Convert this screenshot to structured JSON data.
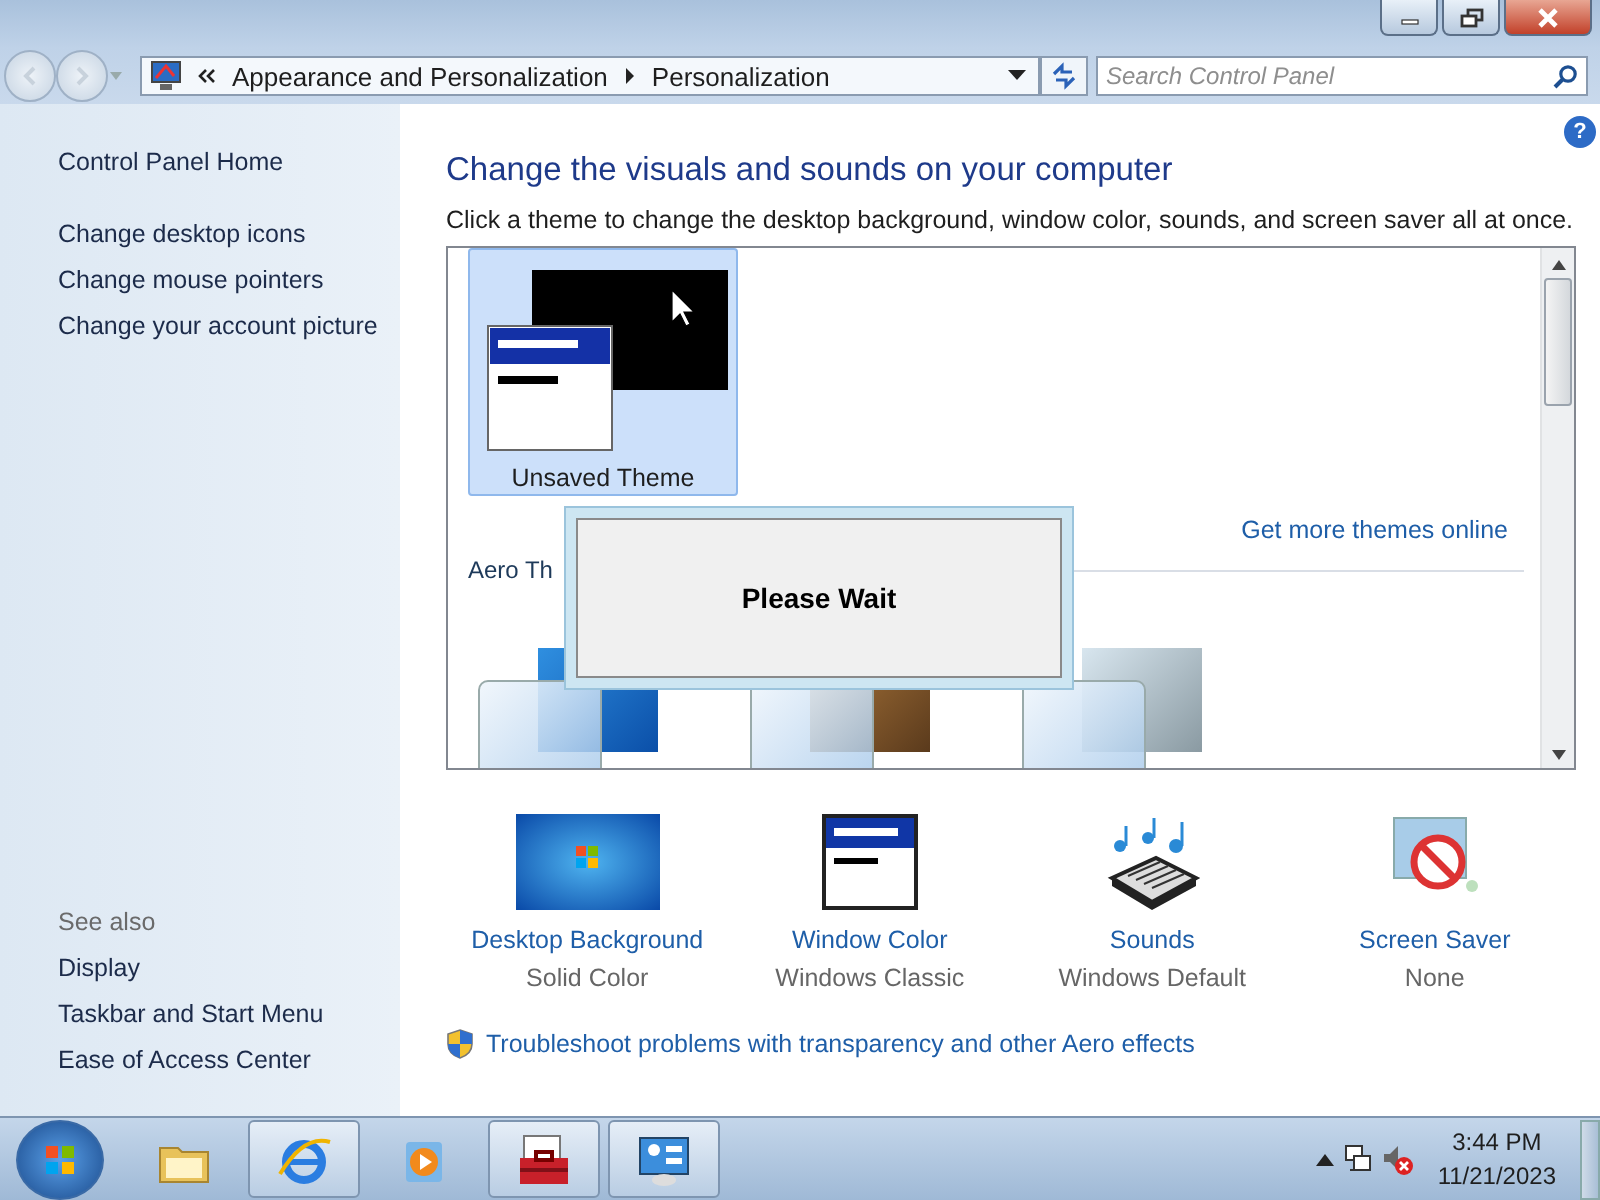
{
  "address_bar": {
    "breadcrumbs": [
      "Appearance and Personalization",
      "Personalization"
    ],
    "search": {
      "placeholder": "Search Control Panel"
    }
  },
  "sidebar": {
    "home": "Control Panel Home",
    "links": [
      "Change desktop icons",
      "Change mouse pointers",
      "Change your account picture"
    ],
    "see_also_label": "See also",
    "see_also": [
      "Display",
      "Taskbar and Start Menu",
      "Ease of Access Center"
    ]
  },
  "main": {
    "help": "?",
    "title": "Change the visuals and sounds on your computer",
    "description": "Click a theme to change the desktop background, window color, sounds, and screen saver all at once.",
    "themes": [
      {
        "label": "Unsaved Theme",
        "selected": true
      }
    ],
    "more_link": "Get more themes online",
    "section_label": "Aero Th",
    "settings": [
      {
        "kind": "background",
        "label": "Desktop Background",
        "value": "Solid Color"
      },
      {
        "kind": "color",
        "label": "Window Color",
        "value": "Windows Classic"
      },
      {
        "kind": "sounds",
        "label": "Sounds",
        "value": "Windows Default"
      },
      {
        "kind": "saver",
        "label": "Screen Saver",
        "value": "None"
      }
    ],
    "troubleshoot": "Troubleshoot problems with transparency and other Aero effects"
  },
  "dialog": {
    "message": "Please Wait"
  },
  "taskbar": {
    "apps": [
      {
        "kind": "folder",
        "selected": false
      },
      {
        "kind": "browser",
        "selected": true
      },
      {
        "kind": "media",
        "selected": false
      },
      {
        "kind": "toolbox",
        "selected": true
      },
      {
        "kind": "control",
        "selected": true
      }
    ],
    "time": "3:44 PM",
    "date": "11/21/2023"
  }
}
